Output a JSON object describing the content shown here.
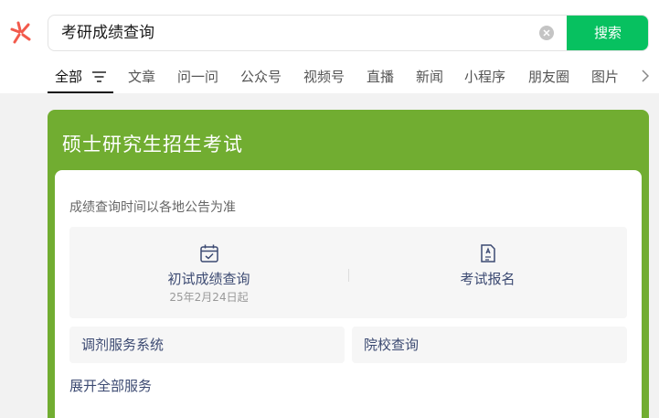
{
  "search": {
    "query": "考研成绩查询",
    "button_label": "搜索"
  },
  "tabs": [
    {
      "label": "全部"
    },
    {
      "label": "文章"
    },
    {
      "label": "问一问"
    },
    {
      "label": "公众号"
    },
    {
      "label": "视频号"
    },
    {
      "label": "直播"
    },
    {
      "label": "新闻"
    },
    {
      "label": "小程序"
    },
    {
      "label": "朋友圈"
    },
    {
      "label": "图片"
    }
  ],
  "card": {
    "title": "硕士研究生招生考试",
    "notice": "成绩查询时间以各地公告为准",
    "services": [
      {
        "label": "初试成绩查询",
        "sub": "25年2月24日起",
        "icon": "calendar-check-icon"
      },
      {
        "label": "考试报名",
        "icon": "document-icon"
      }
    ],
    "links": [
      {
        "label": "调剂服务系统"
      },
      {
        "label": "院校查询"
      }
    ],
    "expand_label": "展开全部服务"
  },
  "colors": {
    "accent_green": "#07c160",
    "card_green": "#71ad31",
    "link_blue": "#3c4a72"
  }
}
